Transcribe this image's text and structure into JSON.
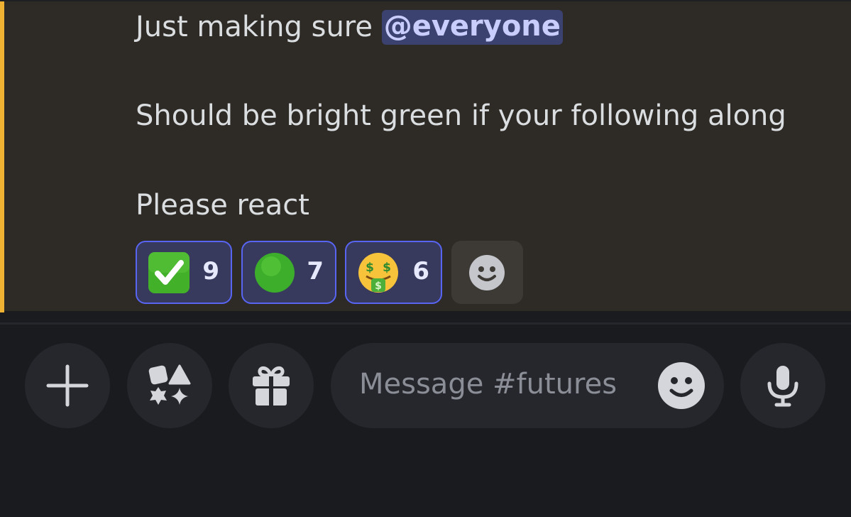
{
  "message": {
    "line1_prefix": "Just making sure ",
    "mention": "@everyone",
    "line2": "Should be bright green if your following along",
    "line3": "Please react"
  },
  "reactions": [
    {
      "icon": "white-check-mark-emoji",
      "count": "9"
    },
    {
      "icon": "green-circle-emoji",
      "count": "7"
    },
    {
      "icon": "money-mouth-face-emoji",
      "count": "6"
    }
  ],
  "composer": {
    "placeholder": "Message #futures"
  },
  "colors": {
    "message_highlight_bg": "#2e2a25",
    "mention_bar": "#f0b232",
    "mention_bg": "#3c4270",
    "reaction_border": "#5865f2",
    "reaction_bg": "#373a5d",
    "app_bg": "#1a1b1f",
    "button_bg": "#26272d"
  }
}
